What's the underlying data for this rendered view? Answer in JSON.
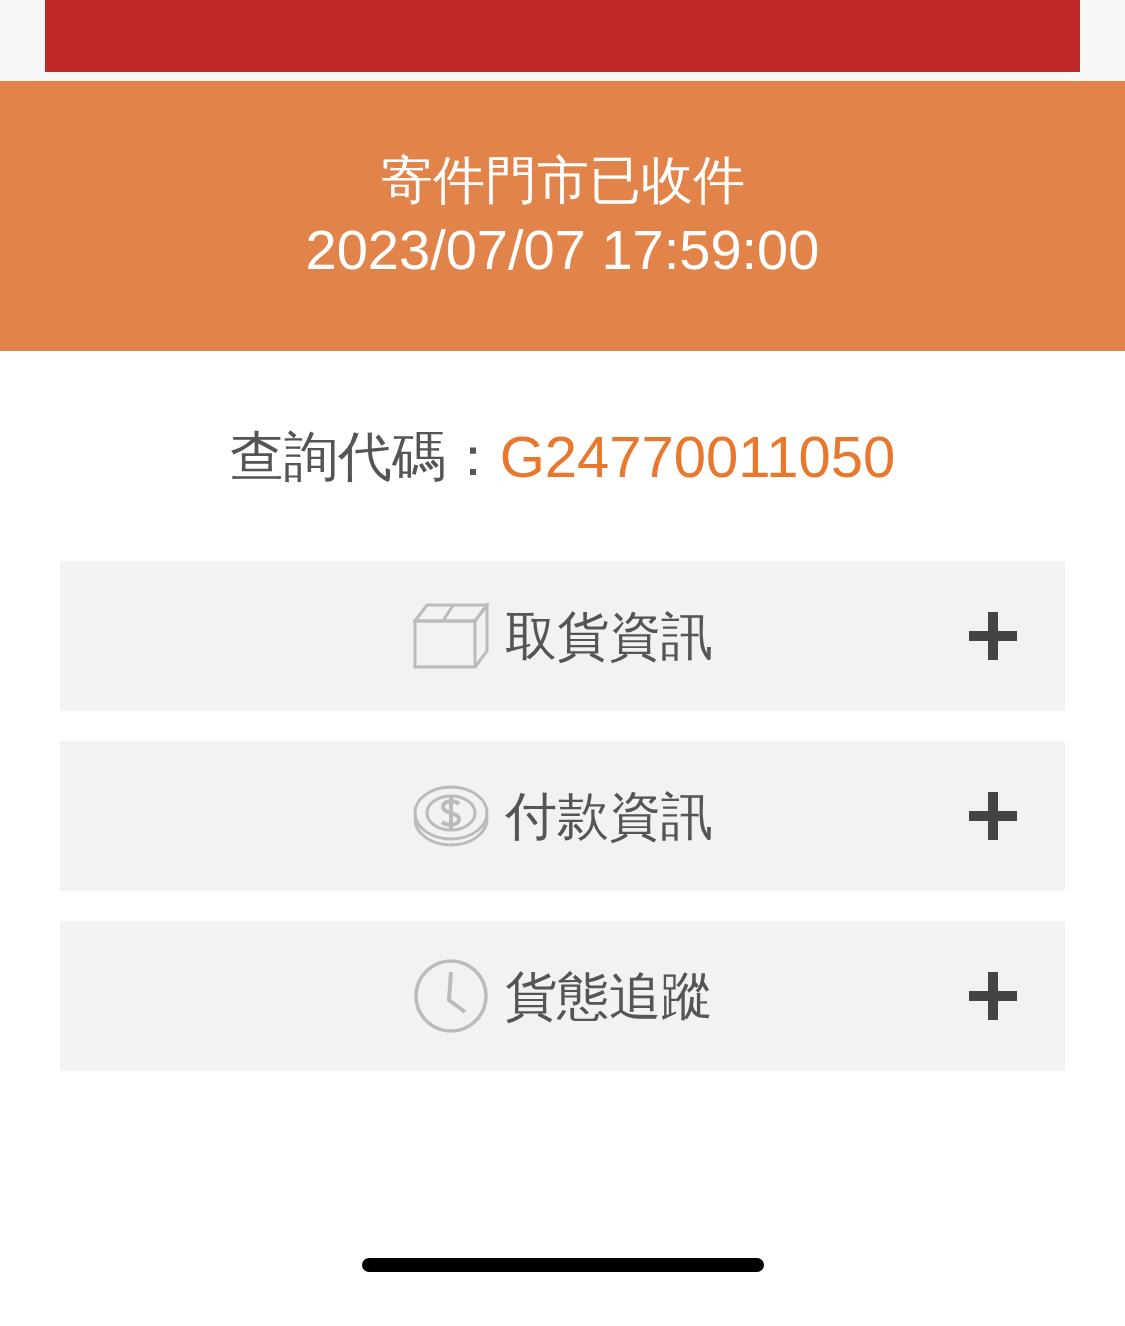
{
  "banner": {
    "status": "寄件門市已收件",
    "datetime": "2023/07/07 17:59:00"
  },
  "query": {
    "label": "查詢代碼：",
    "code": "G24770011050"
  },
  "sections": [
    {
      "label": "取貨資訊",
      "kind": "box",
      "expanded": false
    },
    {
      "label": "付款資訊",
      "kind": "coin",
      "expanded": false
    },
    {
      "label": "貨態追蹤",
      "kind": "clock",
      "expanded": false
    }
  ]
}
